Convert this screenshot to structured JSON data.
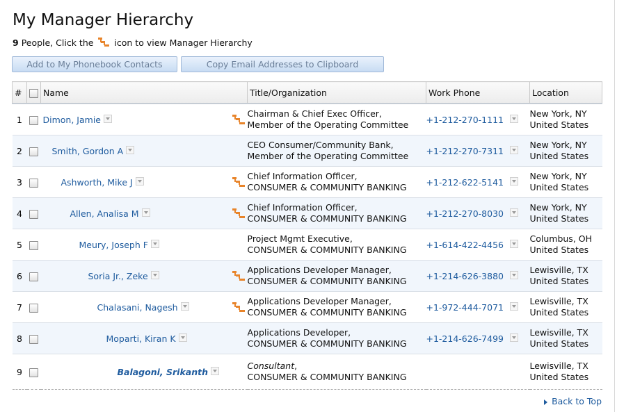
{
  "page": {
    "title": "My Manager Hierarchy",
    "count": "9",
    "subtitle_before": "People, Click the",
    "subtitle_after": "icon to view Manager Hierarchy"
  },
  "toolbar": {
    "add_label": "Add to My Phonebook Contacts",
    "copy_label": "Copy Email Addresses to Clipboard"
  },
  "columns": {
    "num": "#",
    "name": "Name",
    "title": "Title/Organization",
    "phone": "Work Phone",
    "location": "Location"
  },
  "rows": [
    {
      "num": "1",
      "name": "Dimon, Jamie",
      "title1": "Chairman & Chief Exec Officer,",
      "title2": "Member of the Operating Committee",
      "phone": "+1-212-270-1111",
      "loc1": "New York, NY",
      "loc2": "United States"
    },
    {
      "num": "2",
      "name": "Smith, Gordon A",
      "title1": "CEO Consumer/Community Bank,",
      "title2": "Member of the Operating Committee",
      "phone": "+1-212-270-7311",
      "loc1": "New York, NY",
      "loc2": "United States"
    },
    {
      "num": "3",
      "name": "Ashworth, Mike J",
      "title1": "Chief Information Officer,",
      "title2": "CONSUMER & COMMUNITY BANKING",
      "phone": "+1-212-622-5141",
      "loc1": "New York, NY",
      "loc2": "United States"
    },
    {
      "num": "4",
      "name": "Allen, Analisa M",
      "title1": "Chief Information Officer,",
      "title2": "CONSUMER & COMMUNITY BANKING",
      "phone": "+1-212-270-8030",
      "loc1": "New York, NY",
      "loc2": "United States"
    },
    {
      "num": "5",
      "name": "Meury, Joseph F",
      "title1": "Project Mgmt Executive,",
      "title2": "CONSUMER & COMMUNITY BANKING",
      "phone": "+1-614-422-4456",
      "loc1": "Columbus, OH",
      "loc2": "United States"
    },
    {
      "num": "6",
      "name": "Soria Jr., Zeke",
      "title1": "Applications Developer Manager,",
      "title2": "CONSUMER & COMMUNITY BANKING",
      "phone": "+1-214-626-3880",
      "loc1": "Lewisville, TX",
      "loc2": "United States"
    },
    {
      "num": "7",
      "name": "Chalasani, Nagesh",
      "title1": "Applications Developer Manager,",
      "title2": "CONSUMER & COMMUNITY BANKING",
      "phone": "+1-972-444-7071",
      "loc1": "Lewisville, TX",
      "loc2": "United States"
    },
    {
      "num": "8",
      "name": "Moparti, Kiran K",
      "title1": "Applications Developer,",
      "title2": "CONSUMER & COMMUNITY BANKING",
      "phone": "+1-214-626-7499",
      "loc1": "Lewisville, TX",
      "loc2": "United States"
    },
    {
      "num": "9",
      "name": "Balagoni, Srikanth",
      "title1": "Consultant",
      "title1_suffix": ",",
      "title2": "CONSUMER & COMMUNITY BANKING",
      "phone": "",
      "loc1": "Lewisville, TX",
      "loc2": "United States"
    }
  ],
  "footer": {
    "back_to_top": "Back to Top"
  },
  "colors": {
    "link": "#1e5b9e",
    "row_alt": "#f1f6fc",
    "icon": "#e8842a"
  },
  "icons": {
    "hierarchy": "org-hierarchy-icon",
    "dropdown": "chevron-down-icon",
    "back": "triangle-right-icon"
  }
}
